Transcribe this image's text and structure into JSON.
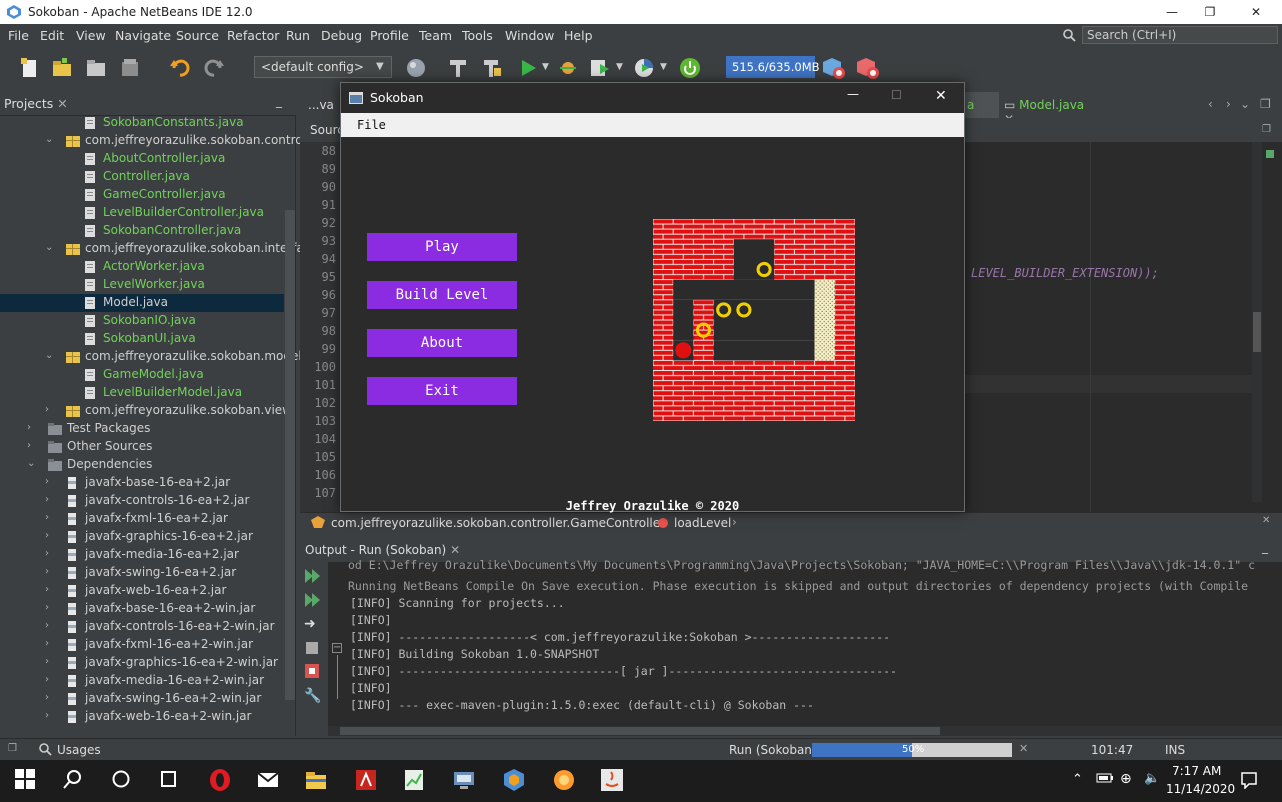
{
  "window": {
    "title": "Sokoban - Apache NetBeans IDE 12.0",
    "minimize": "—",
    "maximize": "❐",
    "close": "✕"
  },
  "menubar": {
    "items": [
      "File",
      "Edit",
      "View",
      "Navigate",
      "Source",
      "Refactor",
      "Run",
      "Debug",
      "Profile",
      "Team",
      "Tools",
      "Window",
      "Help"
    ],
    "search_placeholder": "Search (Ctrl+I)"
  },
  "toolbar": {
    "config": "<default config>",
    "memory": "515.6/635.0MB",
    "icons": [
      "new-file-icon",
      "new-project-icon",
      "open-project-icon",
      "close-project-icon",
      "undo-icon",
      "redo-icon",
      "globe-icon",
      "build-icon",
      "clean-build-icon",
      "run-icon",
      "debug-icon",
      "profile-icon",
      "gc-icon"
    ]
  },
  "projects": {
    "tab_label": "Projects",
    "tree": [
      {
        "label": "SokobanConstants.java",
        "style": "green"
      },
      {
        "label": "com.jeffreyorazulike.sokoban.controll",
        "style": "normal"
      },
      {
        "label": "AboutController.java",
        "style": "green"
      },
      {
        "label": "Controller.java",
        "style": "green"
      },
      {
        "label": "GameController.java",
        "style": "green"
      },
      {
        "label": "LevelBuilderController.java",
        "style": "green"
      },
      {
        "label": "SokobanController.java",
        "style": "green"
      },
      {
        "label": "com.jeffreyorazulike.sokoban.interfac",
        "style": "normal"
      },
      {
        "label": "ActorWorker.java",
        "style": "green"
      },
      {
        "label": "LevelWorker.java",
        "style": "green"
      },
      {
        "label": "Model.java",
        "style": "normal"
      },
      {
        "label": "SokobanIO.java",
        "style": "green"
      },
      {
        "label": "SokobanUI.java",
        "style": "green"
      },
      {
        "label": "com.jeffreyorazulike.sokoban.model",
        "style": "normal"
      },
      {
        "label": "GameModel.java",
        "style": "green"
      },
      {
        "label": "LevelBuilderModel.java",
        "style": "green"
      },
      {
        "label": "com.jeffreyorazulike.sokoban.view",
        "style": "normal"
      },
      {
        "label": "Test Packages",
        "style": "normal"
      },
      {
        "label": "Other Sources",
        "style": "normal"
      },
      {
        "label": "Dependencies",
        "style": "normal"
      },
      {
        "label": "javafx-base-16-ea+2.jar",
        "style": "normal"
      },
      {
        "label": "javafx-controls-16-ea+2.jar",
        "style": "normal"
      },
      {
        "label": "javafx-fxml-16-ea+2.jar",
        "style": "normal"
      },
      {
        "label": "javafx-graphics-16-ea+2.jar",
        "style": "normal"
      },
      {
        "label": "javafx-media-16-ea+2.jar",
        "style": "normal"
      },
      {
        "label": "javafx-swing-16-ea+2.jar",
        "style": "normal"
      },
      {
        "label": "javafx-web-16-ea+2.jar",
        "style": "normal"
      },
      {
        "label": "javafx-base-16-ea+2-win.jar",
        "style": "normal"
      },
      {
        "label": "javafx-controls-16-ea+2-win.jar",
        "style": "normal"
      },
      {
        "label": "javafx-fxml-16-ea+2-win.jar",
        "style": "normal"
      },
      {
        "label": "javafx-graphics-16-ea+2-win.jar",
        "style": "normal"
      },
      {
        "label": "javafx-media-16-ea+2-win.jar",
        "style": "normal"
      },
      {
        "label": "javafx-swing-16-ea+2-win.jar",
        "style": "normal"
      },
      {
        "label": "javafx-web-16-ea+2-win.jar",
        "style": "normal"
      }
    ]
  },
  "editor": {
    "tabs": [
      "...va",
      "a",
      "Model.java"
    ],
    "source_tab": "Sourc",
    "line_numbers": [
      "88",
      "89",
      "90",
      "91",
      "92",
      "93",
      "94",
      "95",
      "96",
      "97",
      "98",
      "99",
      "100",
      "101",
      "102",
      "103",
      "104",
      "105",
      "106",
      "107"
    ],
    "code_fragment": "LEVEL_BUILDER_EXTENSION));"
  },
  "breadcrumbs": {
    "class": "com.jeffreyorazulike.sokoban.controller.GameController",
    "method": "loadLevel"
  },
  "output": {
    "tab_label": "Output - Run (Sokoban)",
    "lines": [
      "od E:\\Jeffrey Orazulike\\Documents\\My Documents\\Programming\\Java\\Projects\\Sokoban; \"JAVA_HOME=C:\\\\Program Files\\\\Java\\\\jdk-14.0.1\" c",
      "Running NetBeans Compile On Save execution. Phase execution is skipped and output directories of dependency projects (with Compile",
      "[INFO] Scanning for projects...",
      "[INFO]",
      "[INFO] -------------------< com.jeffreyorazulike:Sokoban >--------------------",
      "[INFO] Building Sokoban 1.0-SNAPSHOT",
      "[INFO] --------------------------------[ jar ]---------------------------------",
      "[INFO]",
      "[INFO] --- exec-maven-plugin:1.5.0:exec (default-cli) @ Sokoban ---"
    ]
  },
  "statusbar": {
    "usages": "Usages",
    "run_label": "Run (Sokoban)",
    "progress_percent": 50,
    "progress_text": "50%",
    "position": "101:47",
    "mode": "INS"
  },
  "taskbar": {
    "time": "7:17 AM",
    "date": "11/14/2020"
  },
  "sokoban": {
    "title": "Sokoban",
    "menu_file": "File",
    "buttons": [
      "Play",
      "Build Level",
      "About",
      "Exit"
    ],
    "credit": "Jeffrey Orazulike © 2020",
    "colors": {
      "button": "#8b2be2",
      "brick": "#e01010",
      "goal": "#f0d000",
      "player": "#e01010"
    }
  }
}
